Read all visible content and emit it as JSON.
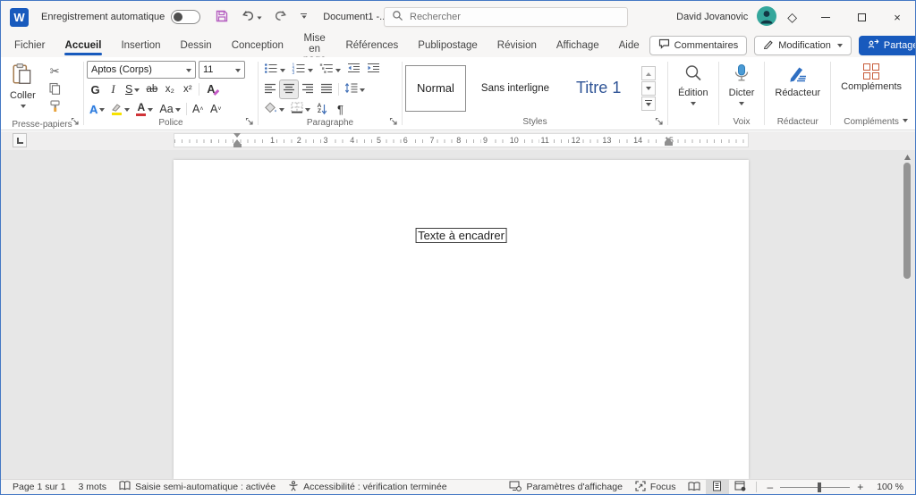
{
  "colors": {
    "accent": "#185abd",
    "heading": "#2f5496",
    "save_icon": "#b55fc0",
    "addins": "#c75b39",
    "mic": "#4a9bd5",
    "window_border": "#4478c4"
  },
  "window": {
    "logo_letter": "W",
    "autosave_label": "Enregistrement automatique",
    "autosave_state": "off",
    "title": "Document1 -...",
    "search_placeholder": "Rechercher",
    "user_name": "David Jovanovic"
  },
  "tabs": [
    {
      "label": "Fichier",
      "active": false
    },
    {
      "label": "Accueil",
      "active": true
    },
    {
      "label": "Insertion",
      "active": false
    },
    {
      "label": "Dessin",
      "active": false
    },
    {
      "label": "Conception",
      "active": false
    },
    {
      "label": "Mise en page",
      "active": false
    },
    {
      "label": "Références",
      "active": false
    },
    {
      "label": "Publipostage",
      "active": false
    },
    {
      "label": "Révision",
      "active": false
    },
    {
      "label": "Affichage",
      "active": false
    },
    {
      "label": "Aide",
      "active": false
    }
  ],
  "top_actions": {
    "comments": "Commentaires",
    "editing_mode": "Modification",
    "share": "Partager"
  },
  "ribbon": {
    "clipboard": {
      "paste": "Coller",
      "group": "Presse-papiers"
    },
    "font": {
      "group": "Police",
      "name": "Aptos (Corps)",
      "size": "11",
      "bold": "G",
      "italic": "I",
      "underline": "S",
      "strike": "ab",
      "subscript": "x₂",
      "superscript": "x²",
      "clear": "A",
      "effects": "A",
      "color": "A",
      "case": "Aa",
      "grow": "A",
      "shrink": "A"
    },
    "paragraph": {
      "group": "Paragraphe",
      "sort_a": "A",
      "sort_z": "Z",
      "pilcrow": "¶"
    },
    "styles": {
      "group": "Styles",
      "items": [
        {
          "label": "Normal",
          "active": true,
          "cls": "s-normal"
        },
        {
          "label": "Sans interligne",
          "active": false,
          "cls": "s-nospace"
        },
        {
          "label": "Titre 1",
          "active": false,
          "cls": "s-title1"
        }
      ]
    },
    "editing": {
      "label": "Édition"
    },
    "voice": {
      "button": "Dicter",
      "group": "Voix"
    },
    "editor": {
      "button": "Rédacteur",
      "group": "Rédacteur"
    },
    "addins": {
      "button": "Compléments",
      "group": "Compléments"
    }
  },
  "ruler": {
    "numbers": [
      "1",
      "2",
      "3",
      "4",
      "5",
      "6",
      "7",
      "8",
      "9",
      "10",
      "11",
      "12",
      "13",
      "14",
      "15"
    ]
  },
  "document": {
    "text": "Texte à encadrer"
  },
  "status": {
    "page": "Page 1 sur 1",
    "words": "3 mots",
    "autocomplete": "Saisie semi-automatique : activée",
    "accessibility": "Accessibilité : vérification terminée",
    "display_settings": "Paramètres d'affichage",
    "focus": "Focus",
    "zoom_out": "–",
    "zoom_in": "+",
    "zoom_level": "100 %"
  }
}
